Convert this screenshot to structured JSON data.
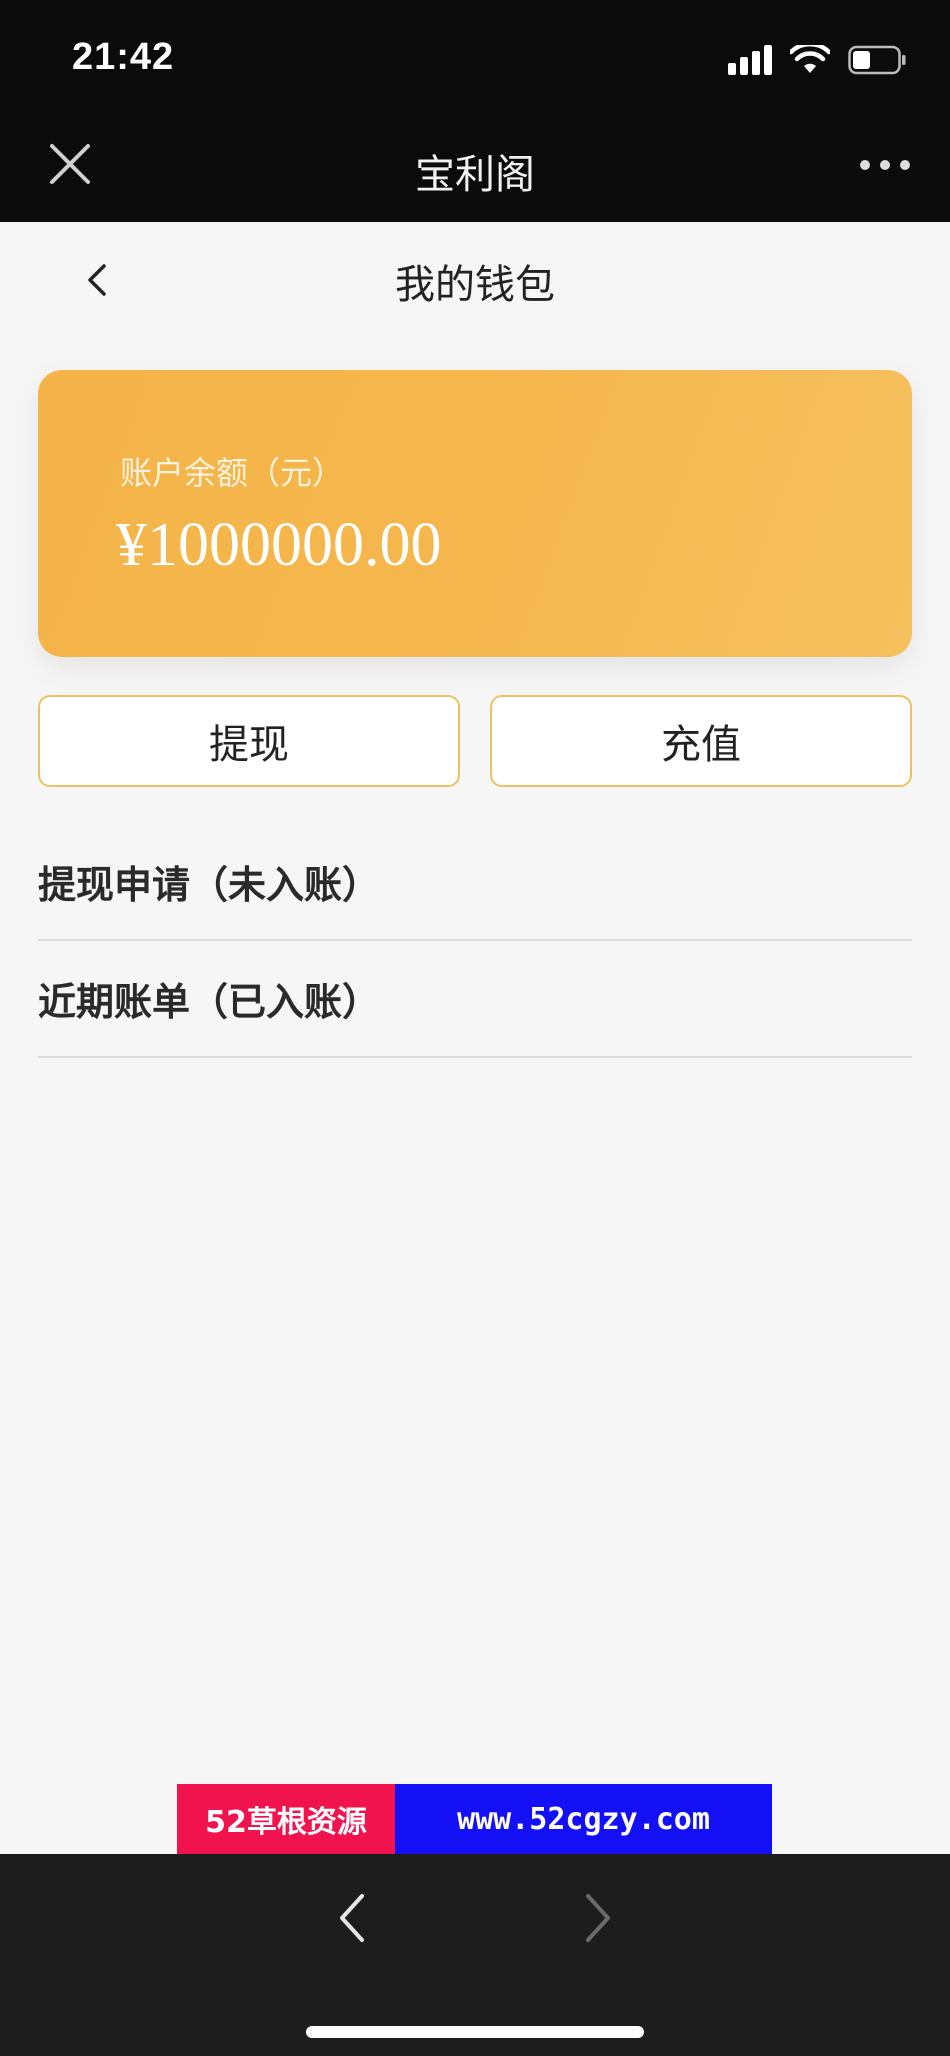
{
  "status_bar": {
    "time": "21:42"
  },
  "title_bar": {
    "title": "宝利阁"
  },
  "page_header": {
    "title": "我的钱包"
  },
  "balance_card": {
    "label": "账户余额（元）",
    "amount": "¥1000000.00",
    "color": "#f5b64c"
  },
  "actions": {
    "withdraw_label": "提现",
    "recharge_label": "充值"
  },
  "list": {
    "items": [
      {
        "label": "提现申请（未入账）"
      },
      {
        "label": "近期账单（已入账）"
      }
    ]
  },
  "promo": {
    "left_text": "52草根资源",
    "right_text": "www.52cgzy.com"
  },
  "bottom_nav": {
    "back_icon": "chevron-left-icon",
    "forward_icon": "chevron-right-icon"
  }
}
